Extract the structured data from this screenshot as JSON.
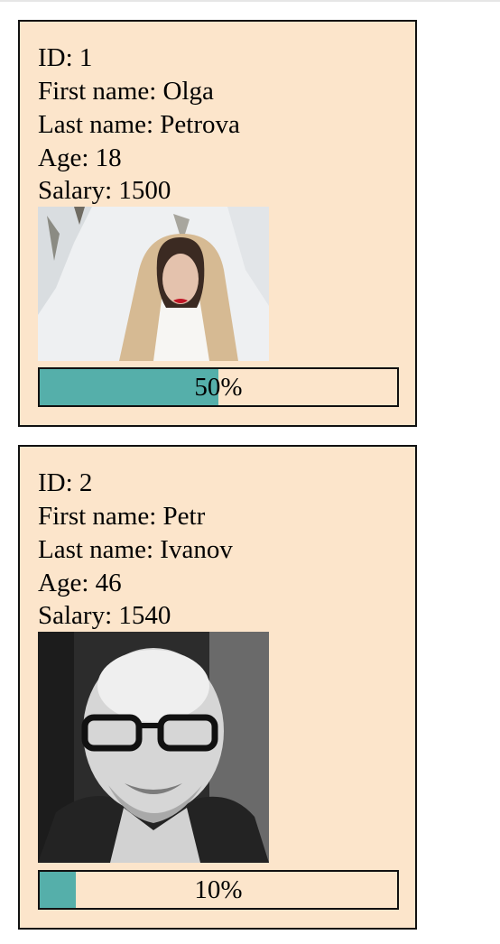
{
  "employees": [
    {
      "id_text": "ID: 1",
      "first_name_text": "First name: Olga",
      "last_name_text": "Last name: Petrova",
      "age_text": "Age: 18",
      "salary_text": "Salary: 1500",
      "progress": 0.5,
      "progress_label": "50%"
    },
    {
      "id_text": "ID: 2",
      "first_name_text": "First name: Petr",
      "last_name_text": "Last name: Ivanov",
      "age_text": "Age: 46",
      "salary_text": "Salary: 1540",
      "progress": 0.1,
      "progress_label": "10%"
    }
  ],
  "colors": {
    "card_background": "#fce5cb",
    "progress_fill": "#55afaa",
    "border": "#111111"
  }
}
